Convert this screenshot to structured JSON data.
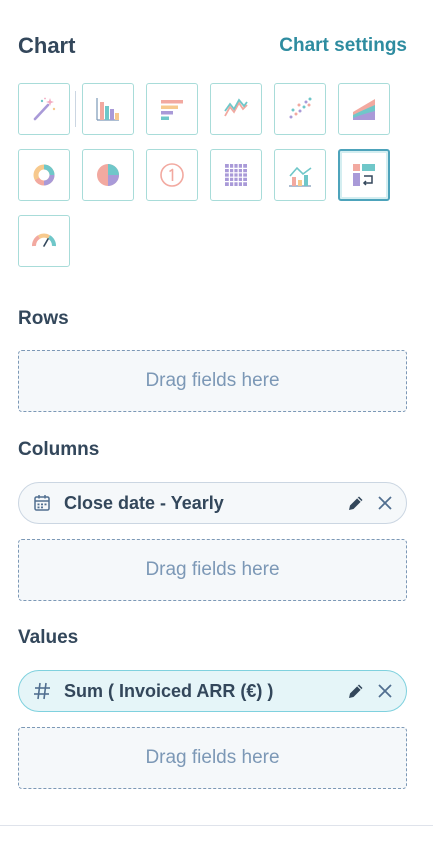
{
  "header": {
    "title": "Chart",
    "settings_link": "Chart settings"
  },
  "chart_types": [
    {
      "name": "magic-suggest",
      "icon": "magic-wand-icon",
      "selected": false
    },
    {
      "name": "vertical-bar",
      "icon": "vertical-bar-chart-icon",
      "selected": false
    },
    {
      "name": "horizontal-bar",
      "icon": "horizontal-bar-chart-icon",
      "selected": false
    },
    {
      "name": "line",
      "icon": "line-chart-icon",
      "selected": false
    },
    {
      "name": "scatter",
      "icon": "scatter-chart-icon",
      "selected": false
    },
    {
      "name": "area",
      "icon": "area-chart-icon",
      "selected": false
    },
    {
      "name": "donut",
      "icon": "donut-chart-icon",
      "selected": false
    },
    {
      "name": "pie",
      "icon": "pie-chart-icon",
      "selected": false
    },
    {
      "name": "summary",
      "icon": "number-summary-icon",
      "selected": false
    },
    {
      "name": "table",
      "icon": "table-grid-icon",
      "selected": false
    },
    {
      "name": "combo",
      "icon": "combo-chart-icon",
      "selected": false
    },
    {
      "name": "pivot",
      "icon": "pivot-table-icon",
      "selected": true
    },
    {
      "name": "gauge",
      "icon": "gauge-chart-icon",
      "selected": false
    }
  ],
  "rows": {
    "label": "Rows",
    "dropzone": "Drag fields here"
  },
  "columns": {
    "label": "Columns",
    "field": {
      "text": "Close date - Yearly",
      "icon": "calendar-icon"
    },
    "dropzone": "Drag fields here"
  },
  "values": {
    "label": "Values",
    "field": {
      "text": "Sum ( Invoiced ARR (€) )",
      "icon": "hash-icon"
    },
    "dropzone": "Drag fields here"
  },
  "colors": {
    "accent": "#2e8ca0",
    "text": "#33475b",
    "muted": "#7c98b6",
    "tile_border": "#a8dcd9",
    "selected_border": "#4da3bb",
    "pill_teal_bg": "#e5f5f8",
    "pill_teal_border": "#7fd1de"
  }
}
